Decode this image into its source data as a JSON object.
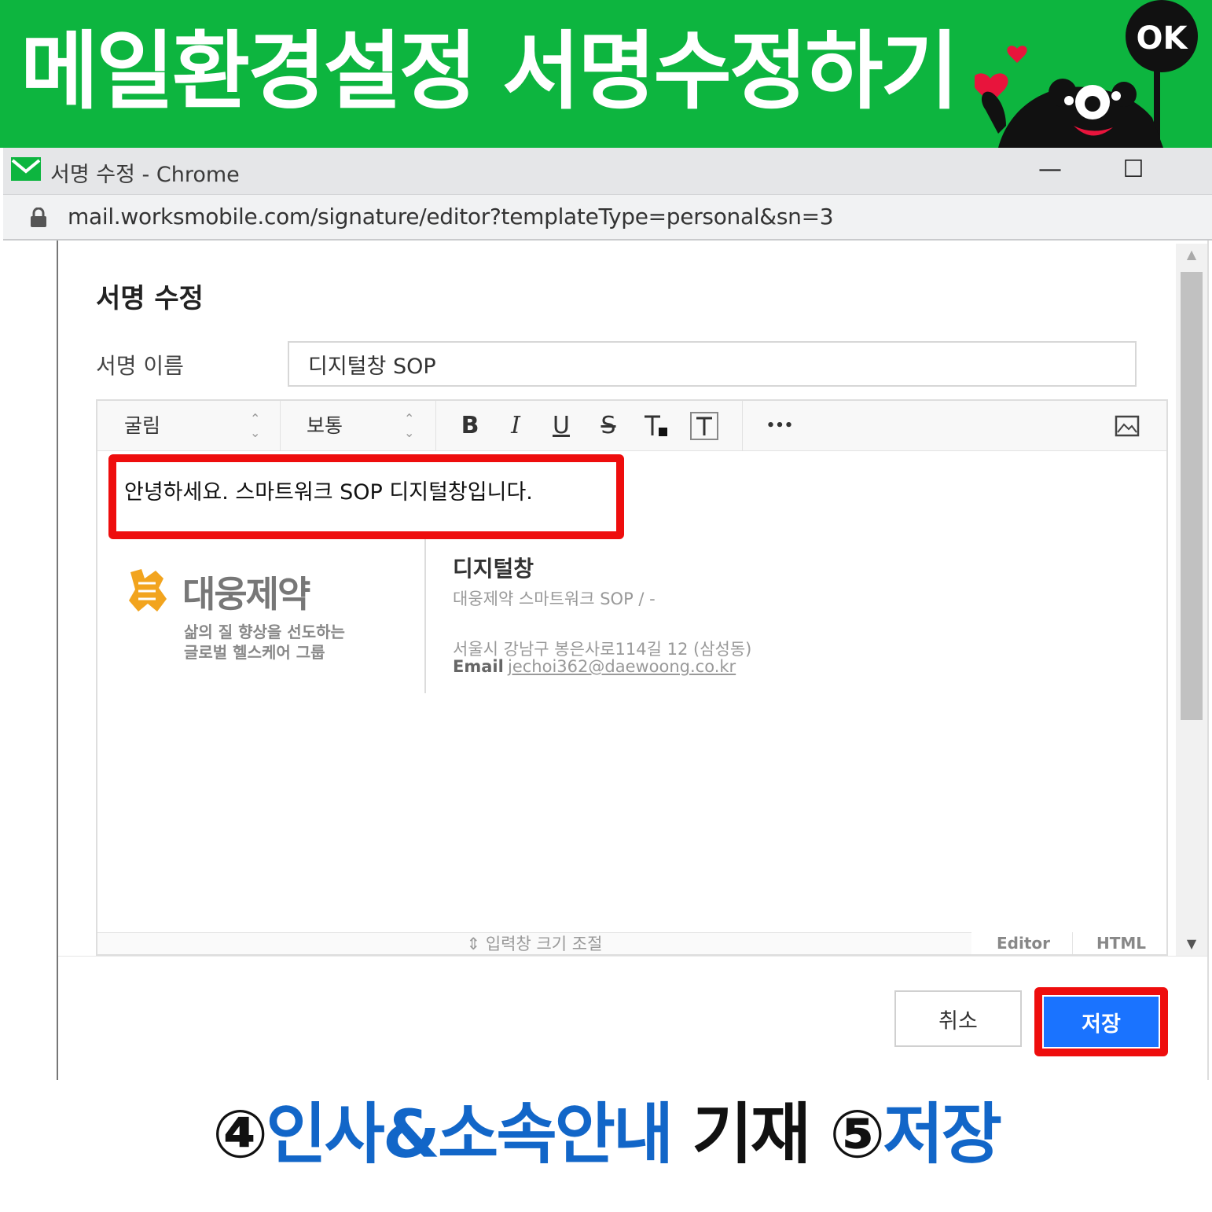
{
  "banner": {
    "title": "메일환경설정 서명수정하기",
    "badge": "OK"
  },
  "window": {
    "title": "서명 수정 - Chrome",
    "minimize": "—",
    "maximize": "☐",
    "url": "mail.worksmobile.com/signature/editor?templateType=personal&sn=3"
  },
  "dialog": {
    "title": "서명 수정",
    "name_label": "서명 이름",
    "name_value": "디지털창 SOP"
  },
  "toolbar": {
    "font": "굴림",
    "size": "보통",
    "bold": "B",
    "italic": "I",
    "underline": "U",
    "strike": "S",
    "more": "•••"
  },
  "editor": {
    "greeting": "안녕하세요. 스마트워크 SOP 디지털창입니다.",
    "logo_text": "대웅제약",
    "logo_sub1": "삶의 질 향상을 선도하는",
    "logo_sub2": "글로벌 헬스케어 그룹",
    "sig_name": "디지털창",
    "sig_dept": "대웅제약 스마트워크 SOP / -",
    "sig_address": "서울시 강남구 봉은사로114길 12 (삼성동)",
    "sig_email_label": "Email",
    "sig_email": "jechoi362@daewoong.co.kr",
    "resize_label": "입력창 크기 조절",
    "tab_editor": "Editor",
    "tab_html": "HTML"
  },
  "buttons": {
    "cancel": "취소",
    "save": "저장"
  },
  "caption": {
    "step4_num": "④",
    "step4_text": "인사&소속안내",
    "middle": " 기재 ",
    "step5_num": "⑤",
    "step5_text": "저장"
  },
  "colors": {
    "banner_green": "#0db53f",
    "highlight_red": "#ee0d0d",
    "save_blue": "#1a73ff",
    "caption_blue": "#1266c8"
  }
}
